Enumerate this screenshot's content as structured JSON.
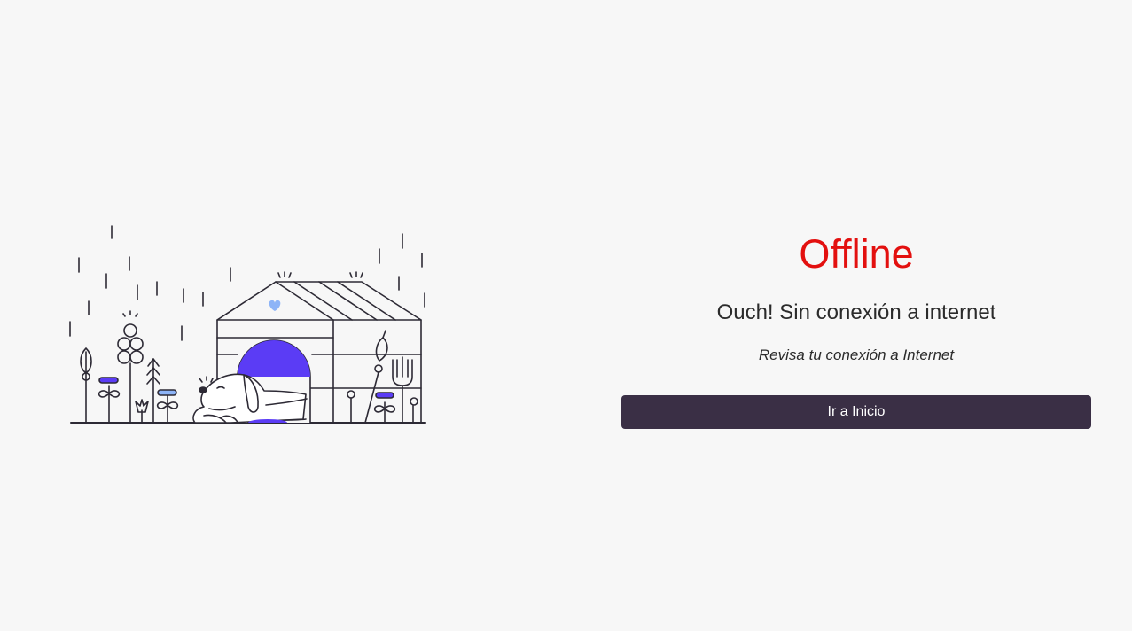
{
  "offline": {
    "title": "Offline",
    "subtitle": "Ouch! Sin conexión a internet",
    "hint": "Revisa tu conexión a Internet",
    "button_label": "Ir a Inicio"
  },
  "colors": {
    "background": "#f7f7f7",
    "title": "#e3100f",
    "button": "#3a2f45",
    "accent_purple": "#5b3cf5",
    "accent_blue": "#8db4f7",
    "line": "#2d2a35"
  },
  "illustration": {
    "icon": "dog-house-rain-illustration"
  }
}
